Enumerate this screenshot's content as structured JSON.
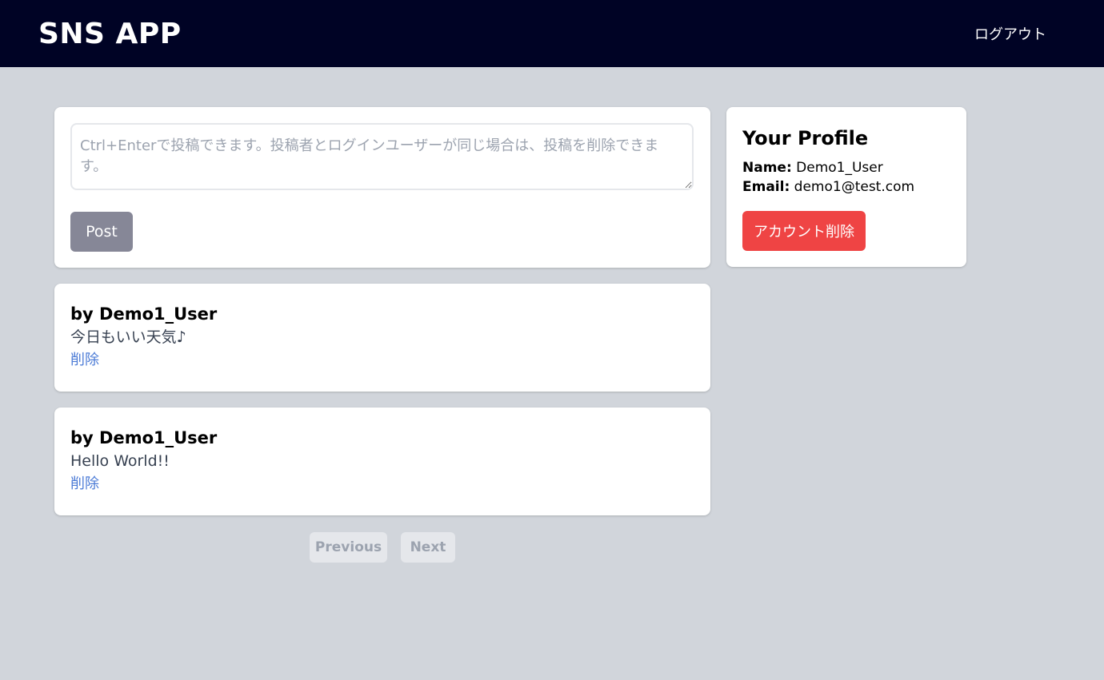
{
  "header": {
    "title": "SNS APP",
    "logout_label": "ログアウト"
  },
  "composer": {
    "placeholder": "Ctrl+Enterで投稿できます。投稿者とログインユーザーが同じ場合は、投稿を削除できます。",
    "value": "",
    "post_label": "Post"
  },
  "posts": [
    {
      "author": "by Demo1_User",
      "body": "今日もいい天気♪",
      "delete_label": "削除"
    },
    {
      "author": "by Demo1_User",
      "body": "Hello World!!",
      "delete_label": "削除"
    }
  ],
  "pagination": {
    "previous_label": "Previous",
    "next_label": "Next"
  },
  "profile": {
    "title": "Your Profile",
    "name_label": "Name:",
    "name_value": "Demo1_User",
    "email_label": "Email:",
    "email_value": "demo1@test.com",
    "delete_account_label": "アカウント削除"
  },
  "colors": {
    "navbar": "#000325",
    "background": "#d1d5db",
    "post_button": "#868797",
    "danger": "#ef4444",
    "link": "#4b7bd6"
  }
}
